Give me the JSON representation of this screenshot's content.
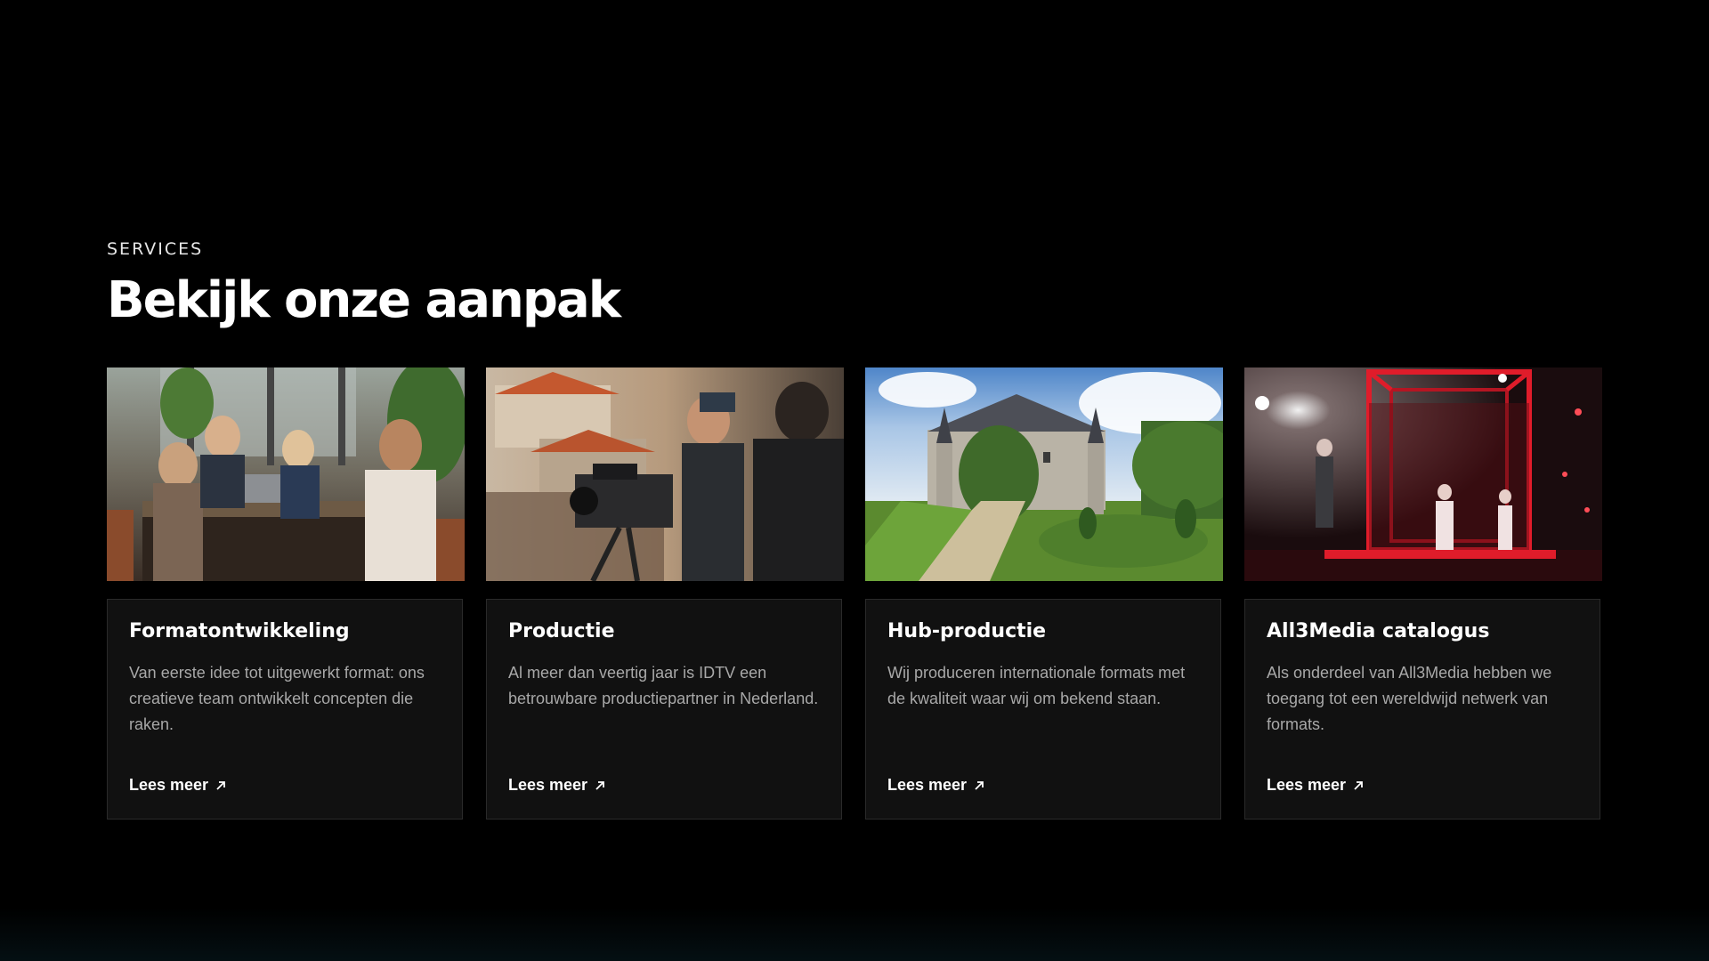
{
  "section": {
    "eyebrow": "SERVICES",
    "title": "Bekijk onze aanpak"
  },
  "cards": [
    {
      "title": "Formatontwikkeling",
      "text": "Van eerste idee tot uitgewerkt format: ons creatieve team ontwikkelt concepten die raken.",
      "link": "Lees meer"
    },
    {
      "title": "Productie",
      "text": "Al meer dan veertig jaar is IDTV een betrouwbare productiepartner in Nederland.",
      "link": "Lees meer"
    },
    {
      "title": "Hub-productie",
      "text": "Wij produceren internationale formats met de kwaliteit waar wij om bekend staan.",
      "link": "Lees meer"
    },
    {
      "title": "All3Media catalogus",
      "text": "Als onderdeel van All3Media hebben we toegang tot een wereldwijd netwerk van formats.",
      "link": "Lees meer"
    }
  ],
  "icons": {
    "link_arrow": "arrow-up-right-icon"
  }
}
